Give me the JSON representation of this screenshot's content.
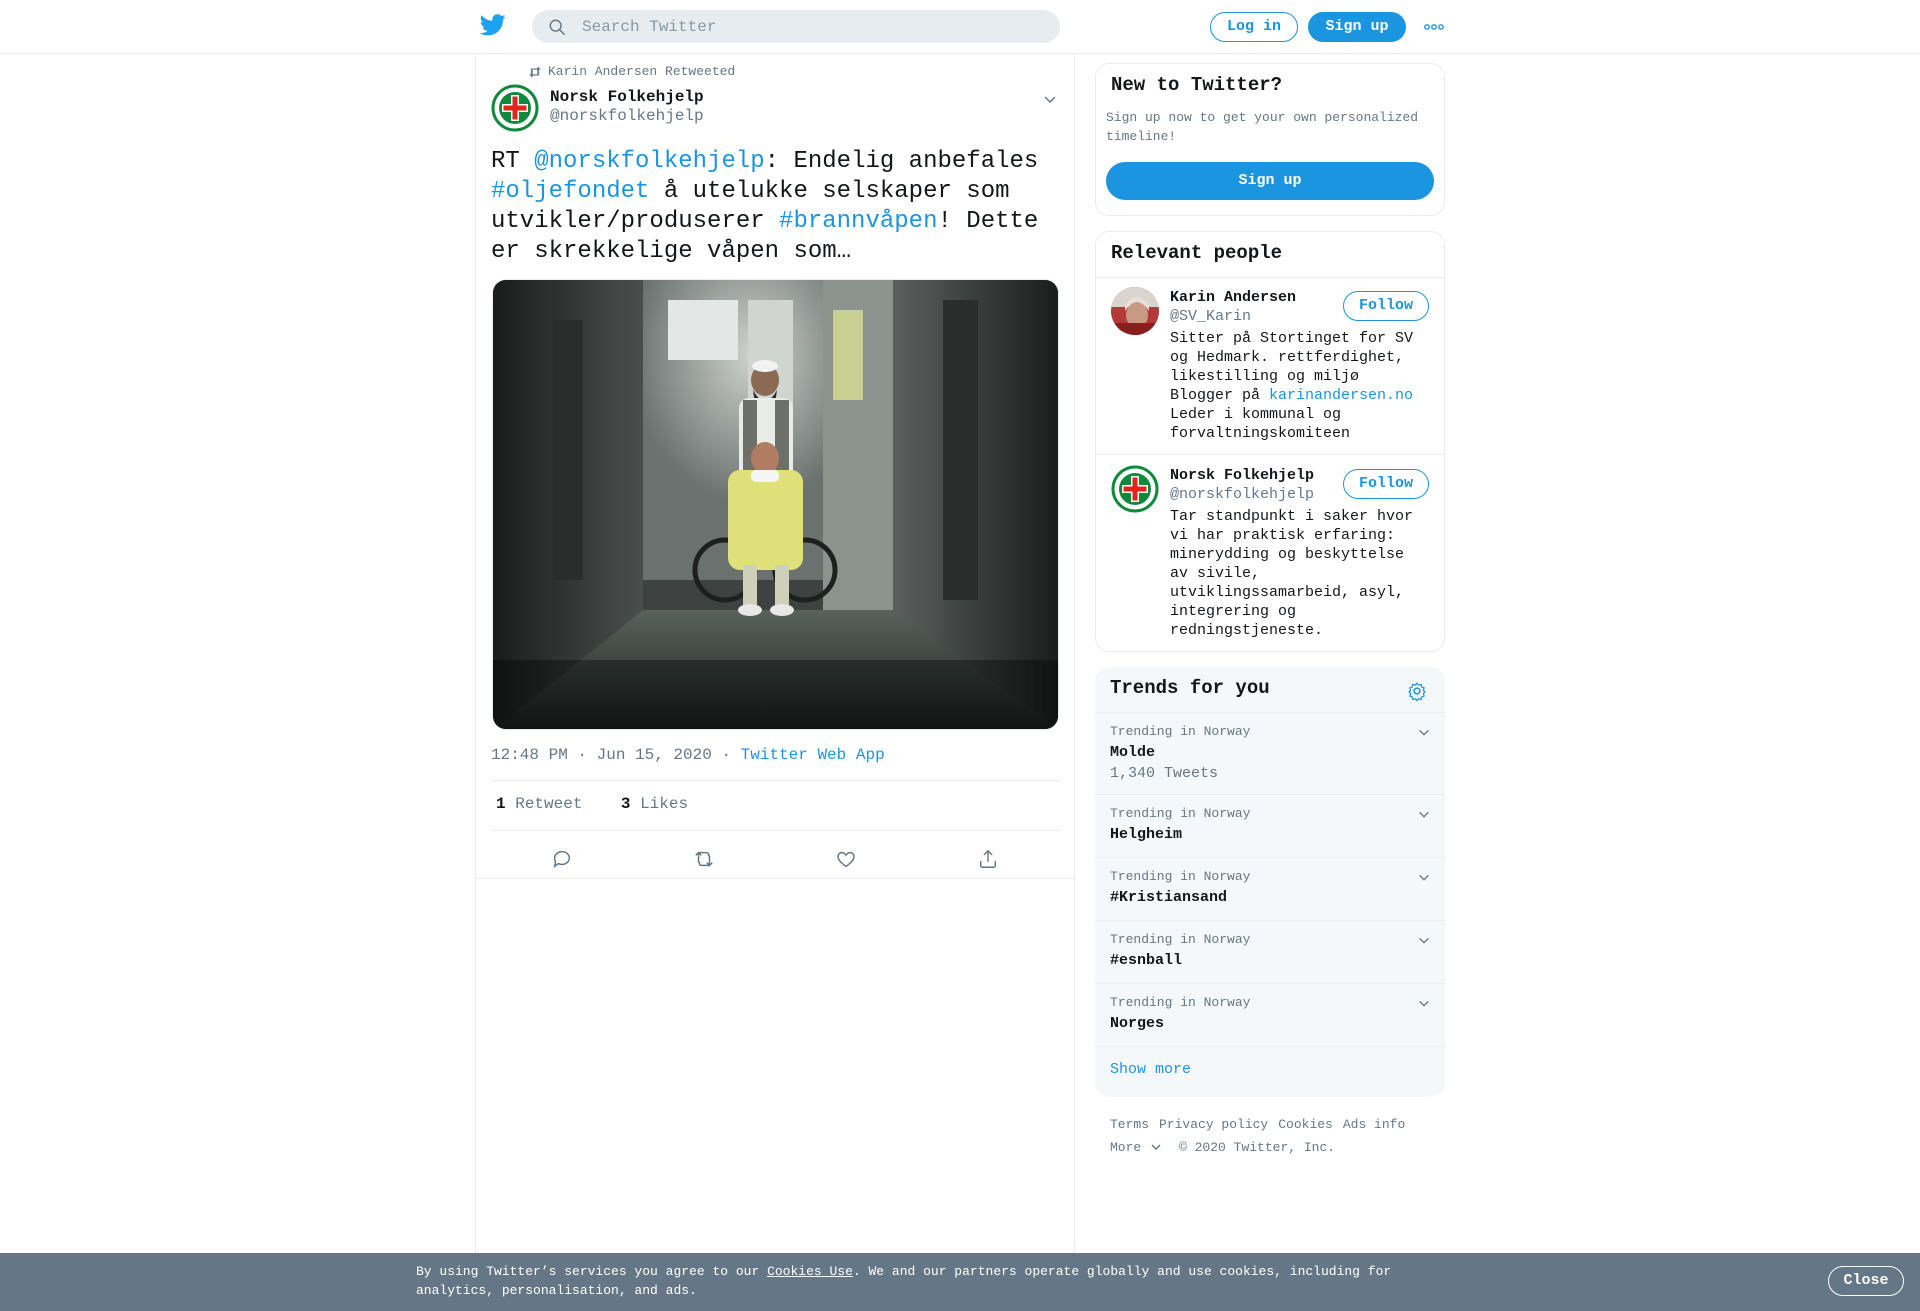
{
  "header": {
    "search_placeholder": "Search Twitter",
    "login_label": "Log in",
    "signup_label": "Sign up",
    "logo_icon": "twitter-bird-icon",
    "more_icon": "more-dots-icon",
    "brand_color": "#1b95e0"
  },
  "tweet": {
    "retweeted_by": "Karin Andersen Retweeted",
    "author_name": "Norsk Folkehjelp",
    "author_handle": "@norskfolkehjelp",
    "text_parts": {
      "p1": "RT ",
      "mention": "@norskfolkehjelp",
      "p2": ": Endelig anbefales ",
      "hashtag1": "#oljefondet",
      "p3": " å utelukke selskaper som utvikler/produserer ",
      "hashtag2": "#brannvåpen",
      "p4": "! Dette er skrekkelige våpen som…"
    },
    "timestamp": "12:48 PM · Jun 15, 2020 · ",
    "source": "Twitter Web App",
    "retweets_count": "1",
    "retweets_label": "Retweet",
    "likes_count": "3",
    "likes_label": "Likes",
    "actions": [
      "reply-icon",
      "retweet-icon",
      "like-icon",
      "share-icon"
    ]
  },
  "sidebar": {
    "new_to_twitter": {
      "title": "New to Twitter?",
      "text": "Sign up now to get your own personalized timeline!",
      "button": "Sign up"
    },
    "relevant_people": {
      "title": "Relevant people",
      "people": [
        {
          "name": "Karin Andersen",
          "handle": "@SV_Karin",
          "follow": "Follow",
          "bio_a": "Sitter på Stortinget for SV og Hedmark. rettferdighet, likestilling og miljø Blogger på ",
          "bio_link": "karinandersen.no",
          "bio_b": " Leder i kommunal og forvaltningskomiteen"
        },
        {
          "name": "Norsk Folkehjelp",
          "handle": "@norskfolkehjelp",
          "follow": "Follow",
          "bio": "Tar standpunkt i saker hvor vi har praktisk erfaring: minerydding og beskyttelse av sivile, utviklingssamarbeid, asyl, integrering og redningstjeneste."
        }
      ]
    },
    "trends": {
      "title": "Trends for you",
      "items": [
        {
          "context": "Trending in Norway",
          "name": "Molde",
          "count": "1,340 Tweets"
        },
        {
          "context": "Trending in Norway",
          "name": "Helgheim"
        },
        {
          "context": "Trending in Norway",
          "name": "#Kristiansand"
        },
        {
          "context": "Trending in Norway",
          "name": "#esnball"
        },
        {
          "context": "Trending in Norway",
          "name": "Norges"
        }
      ],
      "show_more": "Show more"
    },
    "footer": {
      "links": [
        "Terms",
        "Privacy policy",
        "Cookies",
        "Ads info"
      ],
      "more": "More",
      "copyright": "© 2020 Twitter, Inc."
    }
  },
  "cookie_bar": {
    "text_a": "By using Twitter’s services you agree to our ",
    "link": "Cookies Use",
    "text_b": ". We and our partners operate globally and use cookies, including for analytics, personalisation, and ads.",
    "close": "Close"
  }
}
